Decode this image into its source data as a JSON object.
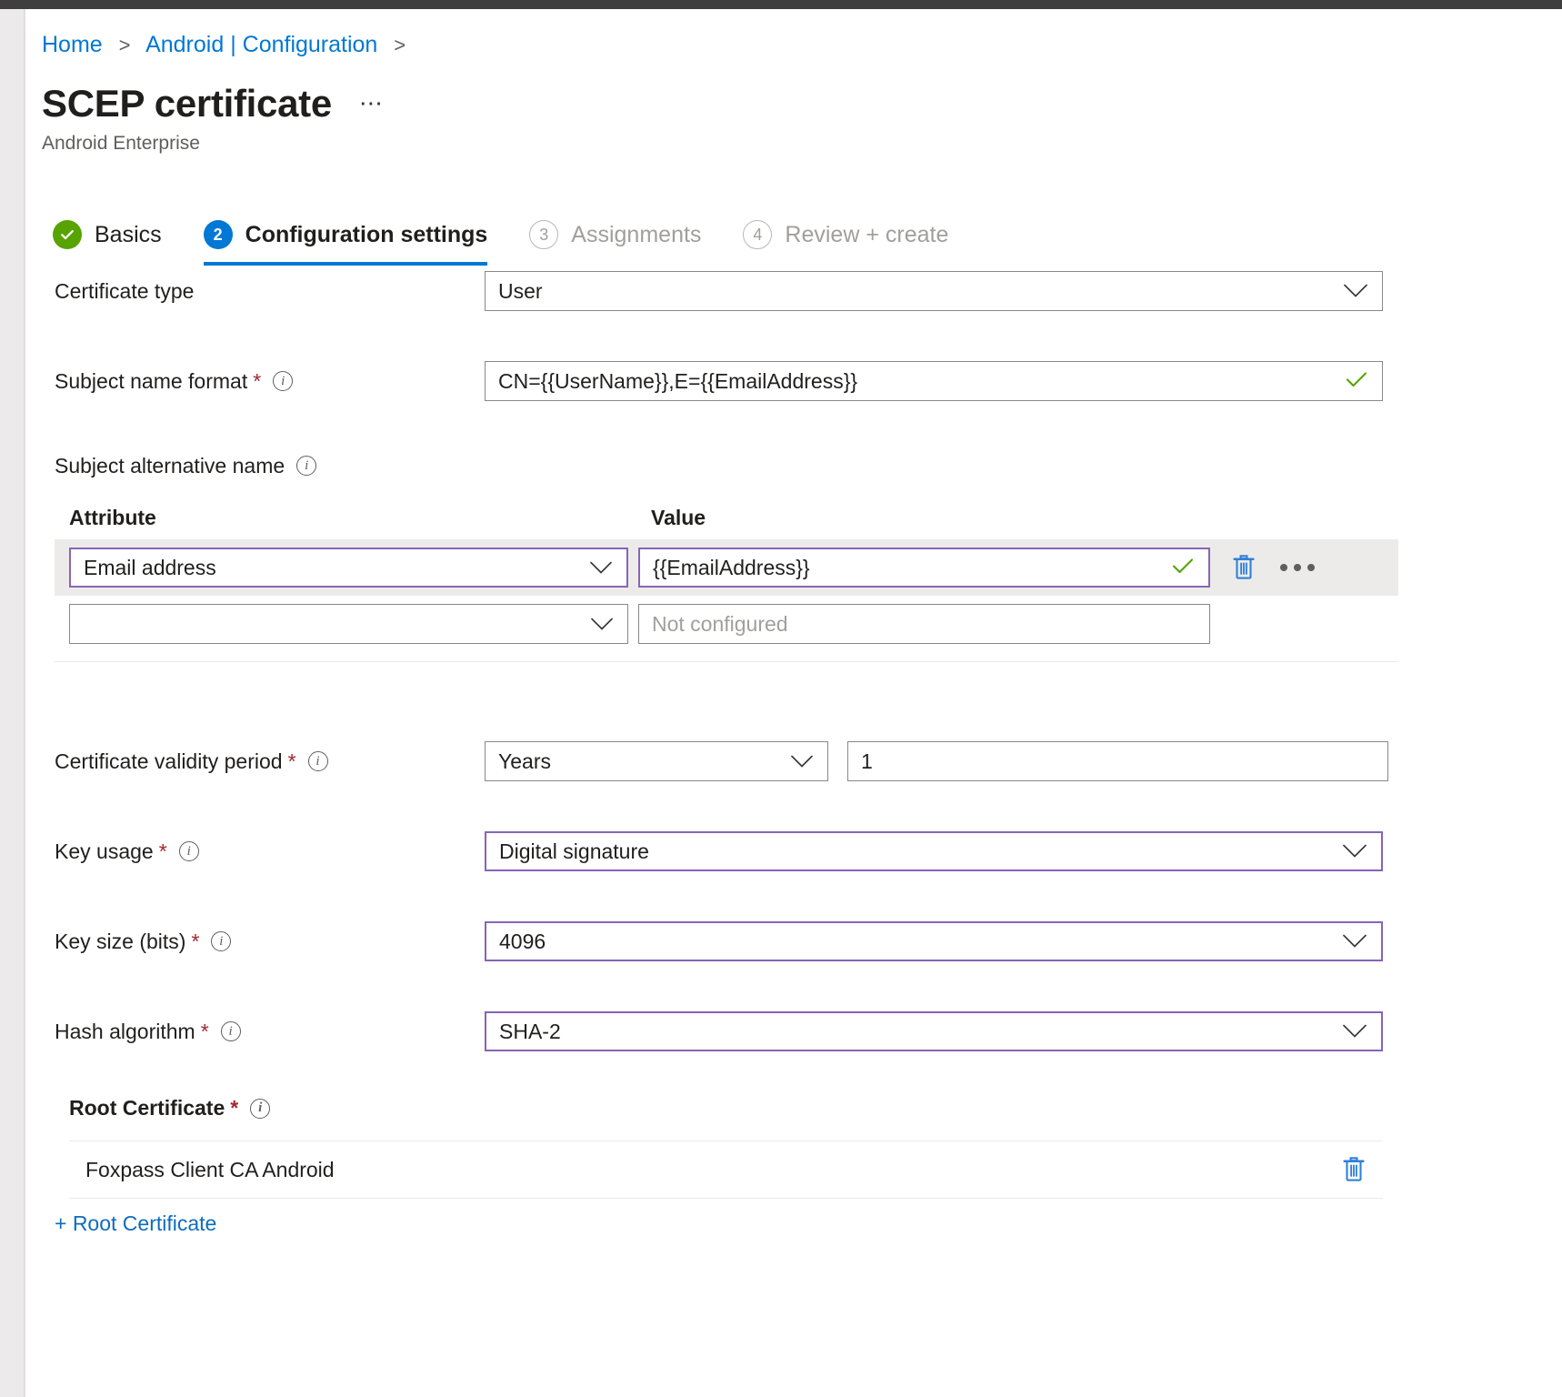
{
  "breadcrumb": {
    "items": [
      {
        "label": "Home"
      },
      {
        "label": "Android | Configuration"
      }
    ],
    "separator": ">"
  },
  "header": {
    "title": "SCEP certificate",
    "more_label": "⋯",
    "subtitle": "Android Enterprise"
  },
  "wizard": {
    "tabs": [
      {
        "badge": "✓",
        "label": "Basics",
        "state": "done"
      },
      {
        "badge": "2",
        "label": "Configuration settings",
        "state": "current"
      },
      {
        "badge": "3",
        "label": "Assignments",
        "state": "pending"
      },
      {
        "badge": "4",
        "label": "Review + create",
        "state": "pending"
      }
    ]
  },
  "form": {
    "certificate_type": {
      "label": "Certificate type",
      "value": "User"
    },
    "subject_name_format": {
      "label": "Subject name format",
      "required": "*",
      "value": "CN={{UserName}},E={{EmailAddress}}"
    },
    "subject_alternative_name": {
      "label": "Subject alternative name",
      "columns": {
        "attribute": "Attribute",
        "value": "Value"
      },
      "rows": [
        {
          "attribute": "Email address",
          "value": "{{EmailAddress}}",
          "value_placeholder": "",
          "valid": true
        },
        {
          "attribute": "",
          "value": "",
          "value_placeholder": "Not configured",
          "valid": false
        }
      ]
    },
    "certificate_validity_period": {
      "label": "Certificate validity period",
      "required": "*",
      "unit": "Years",
      "amount": "1"
    },
    "key_usage": {
      "label": "Key usage",
      "required": "*",
      "value": "Digital signature"
    },
    "key_size": {
      "label": "Key size (bits)",
      "required": "*",
      "value": "4096"
    },
    "hash_algorithm": {
      "label": "Hash algorithm",
      "required": "*",
      "value": "SHA-2"
    },
    "root_certificate": {
      "label": "Root Certificate",
      "required": "*",
      "items": [
        {
          "name": "Foxpass Client CA Android"
        }
      ],
      "add_label": "+ Root Certificate"
    }
  },
  "colors": {
    "link": "#0078d4",
    "accent": "#0078d4",
    "focus_border": "#8764b8",
    "valid_check": "#57a300",
    "required_asterisk": "#a4262c",
    "icon_blue": "#2f80d8",
    "done_badge": "#57a300"
  }
}
